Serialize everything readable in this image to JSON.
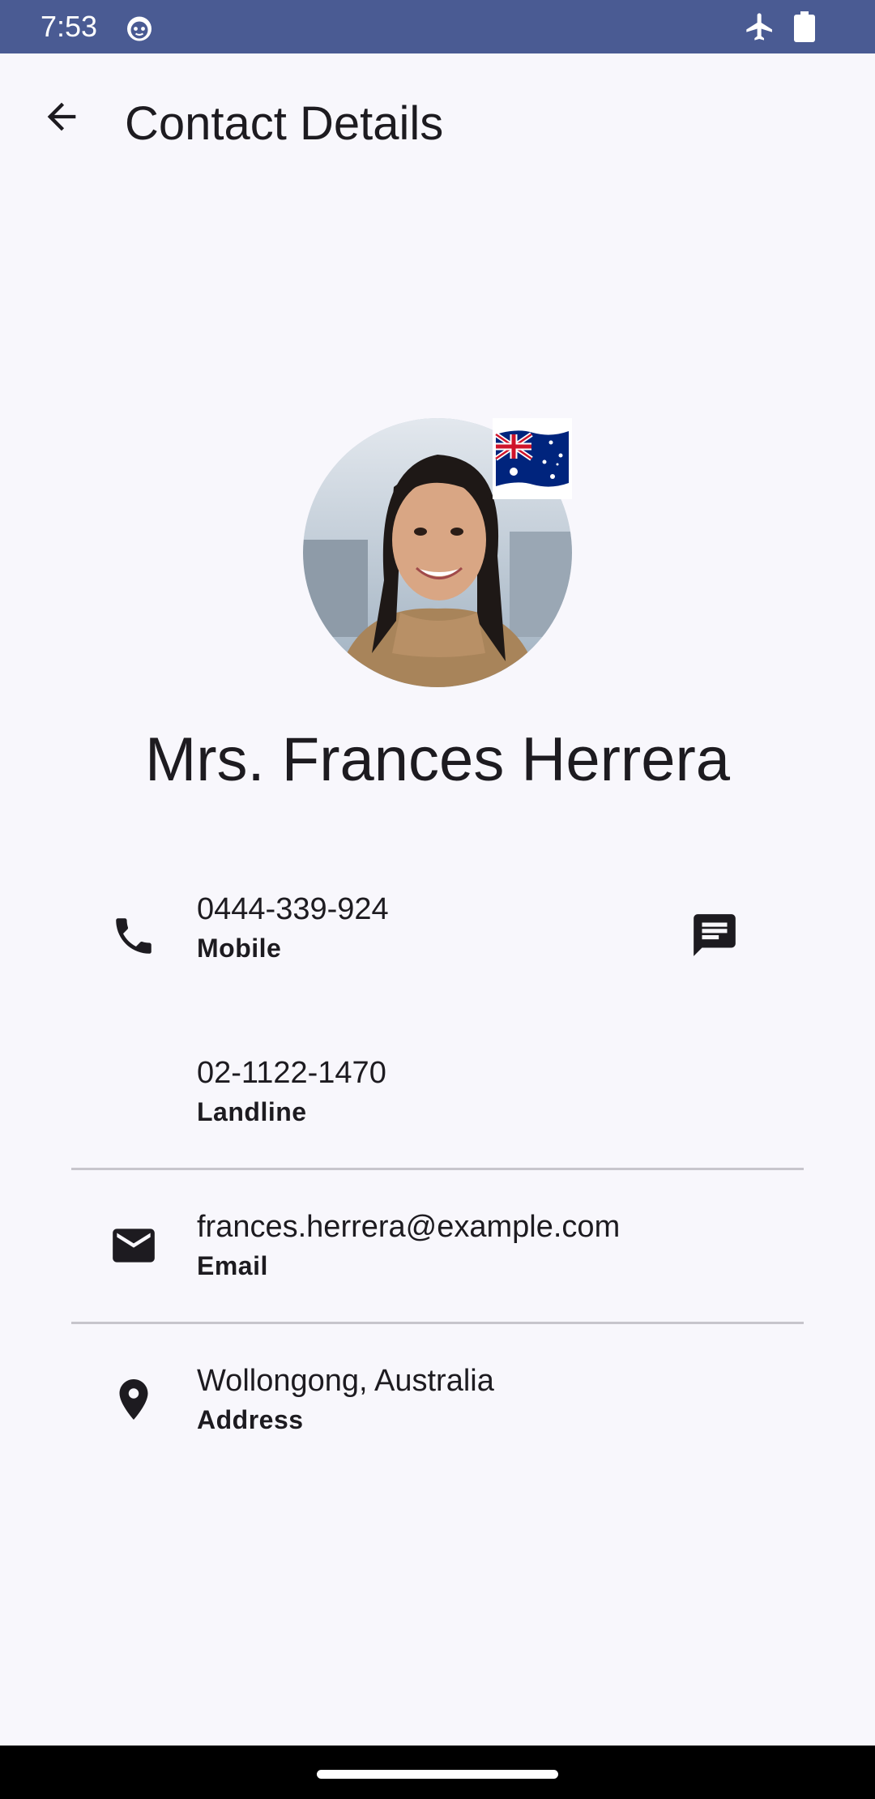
{
  "status_bar": {
    "time": "7:53",
    "icons": [
      "cat-face-icon",
      "airplane-icon",
      "battery-icon"
    ],
    "color": "#4a5b93"
  },
  "app_bar": {
    "title": "Contact Details",
    "back_icon": "arrow-back-icon"
  },
  "contact": {
    "name": "Mrs. Frances Herrera",
    "flag": "australia-flag",
    "phones": [
      {
        "value": "0444-339-924",
        "label": "Mobile",
        "icon": "phone-icon",
        "action_icon": "message-icon"
      },
      {
        "value": "02-1122-1470",
        "label": "Landline"
      }
    ],
    "email": {
      "value": "frances.herrera@example.com",
      "label": "Email",
      "icon": "email-icon"
    },
    "address": {
      "value": "Wollongong, Australia",
      "label": "Address",
      "icon": "location-pin-icon"
    }
  },
  "colors": {
    "background": "#f8f7fc",
    "text": "#1d1b20",
    "divider": "#c7c5cc"
  }
}
